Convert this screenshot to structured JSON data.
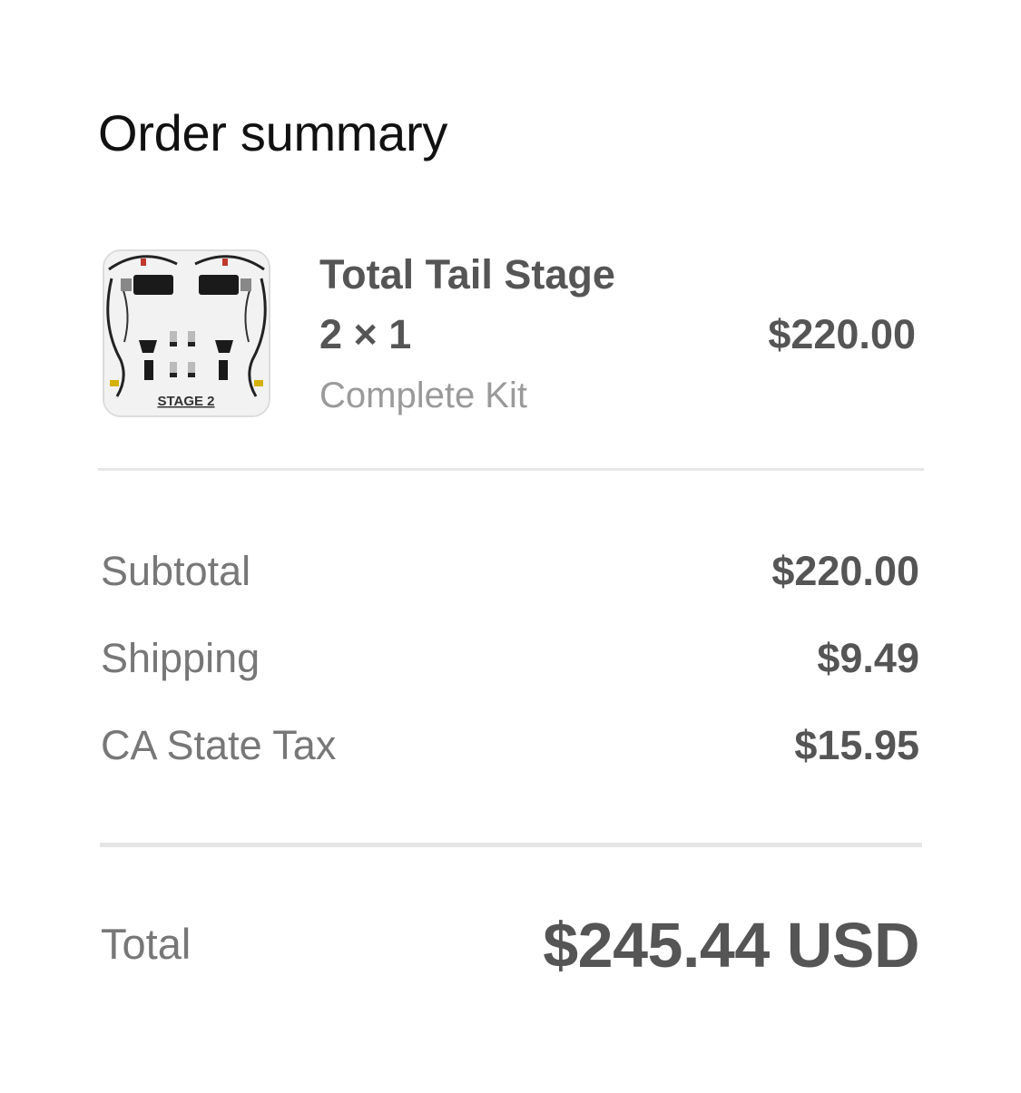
{
  "header": {
    "title": "Order summary"
  },
  "item": {
    "image_icon": "product-thumbnail",
    "image_caption": "STAGE 2",
    "name": "Total Tail Stage",
    "quantity": "2 × 1",
    "variant": "Complete Kit",
    "price": "$220.00"
  },
  "summary": {
    "subtotal_label": "Subtotal",
    "subtotal_value": "$220.00",
    "shipping_label": "Shipping",
    "shipping_value": "$9.49",
    "tax_label": "CA State Tax",
    "tax_value": "$15.95"
  },
  "total": {
    "label": "Total",
    "value": "$245.44 USD"
  },
  "colors": {
    "primary_text": "#555555",
    "secondary_text": "#777777",
    "muted_text": "#9a9a9a",
    "divider": "#e6e6e6"
  }
}
